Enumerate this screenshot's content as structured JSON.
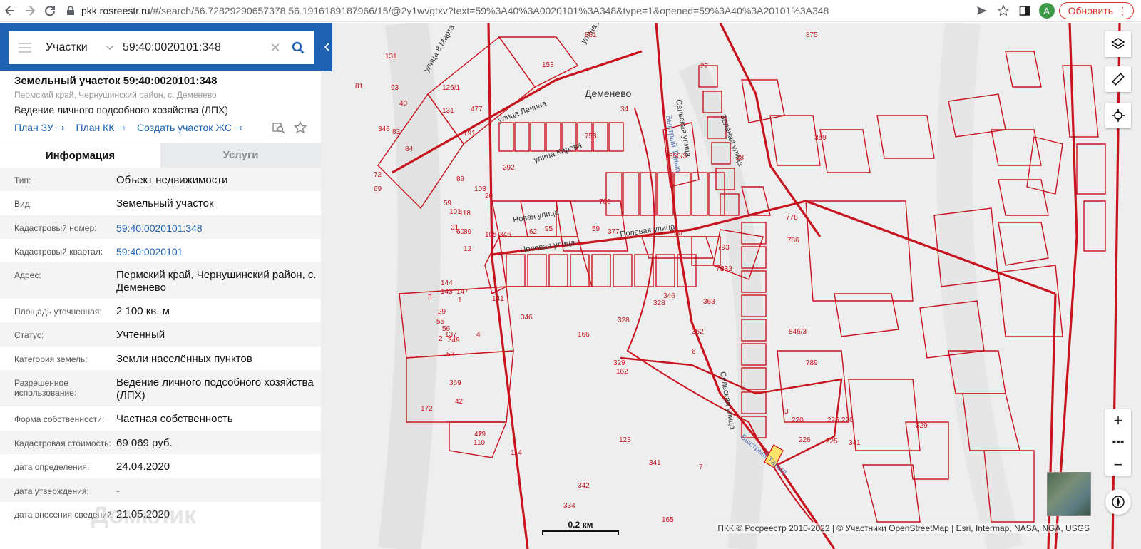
{
  "browser": {
    "url_host": "pkk.rosreestr.ru",
    "url_rest": "/#/search/56.72829290657378,56.1916189187966/15/@2y1wvgtxv?text=59%3A40%3A0020101%3A348&type=1&opened=59%3A40%3A20101%3A348",
    "avatar_letter": "A",
    "update_label": "Обновить",
    "icons": [
      "back-arrow-icon",
      "forward-arrow-icon",
      "reload-icon",
      "lock-icon",
      "send-icon",
      "star-icon",
      "sidebar-icon",
      "kebab-menu-icon"
    ]
  },
  "search": {
    "category": "Участки",
    "query": "59:40:0020101:348"
  },
  "object": {
    "title": "Земельный участок 59:40:0020101:348",
    "address_short": "Пермский край, Чернушинский район, с. Деменево",
    "use": "Ведение личного подсобного хозяйства (ЛПХ)",
    "links": [
      "План ЗУ",
      "План КК",
      "Создать участок ЖС"
    ]
  },
  "tabs": {
    "info": "Информация",
    "services": "Услуги"
  },
  "details": [
    {
      "k": "Тип:",
      "v": "Объект недвижимости"
    },
    {
      "k": "Вид:",
      "v": "Земельный участок"
    },
    {
      "k": "Кадастровый номер:",
      "v": "59:40:0020101:348",
      "link": true
    },
    {
      "k": "Кадастровый квартал:",
      "v": "59:40:0020101",
      "link": true
    },
    {
      "k": "Адрес:",
      "v": "Пермский край, Чернушинский район, с. Деменево"
    },
    {
      "k": "Площадь уточненная:",
      "v": "2 100 кв. м"
    },
    {
      "k": "Статус:",
      "v": "Учтенный"
    },
    {
      "k": "Категория земель:",
      "v": "Земли населённых пунктов"
    },
    {
      "k": "Разрешенное использование:",
      "v": "Ведение личного подсобного хозяйства (ЛПХ)"
    },
    {
      "k": "Форма собственности:",
      "v": "Частная собственность"
    },
    {
      "k": "Кадастровая стоимость:",
      "v": "69 069 руб."
    },
    {
      "k": "дата определения:",
      "v": "24.04.2020"
    },
    {
      "k": "дата утверждения:",
      "v": "-"
    },
    {
      "k": "дата внесения сведений:",
      "v": "21.05.2020"
    }
  ],
  "map": {
    "parcel_color": "#c8141e",
    "highlight_color": "#ffe26a",
    "village_label": "Деменево",
    "street_labels": [
      "Полевая улица",
      "Полевая улица",
      "Новая улица",
      "улица Кирова",
      "улица Ленина",
      "улица 8 Марта",
      "Сельская улица",
      "Сельская улица",
      "Зелёная улица",
      "улица Л"
    ],
    "river_labels": [
      "Быстрый Танып",
      "Быстрый Танып"
    ],
    "parcel_labels": [
      "153",
      "851",
      "40",
      "126/1",
      "131",
      "477",
      "34",
      "42",
      "81",
      "93",
      "131",
      "346",
      "83",
      "84",
      "72",
      "69",
      "89",
      "791",
      "753",
      "850/3",
      "760",
      "760",
      "346",
      "346",
      "346",
      "328",
      "328",
      "363",
      "362",
      "6",
      "793",
      "833",
      "793",
      "28",
      "27",
      "875",
      "359",
      "778",
      "786",
      "846/3",
      "789",
      "3",
      "226",
      "220",
      "225",
      "225",
      "220",
      "329",
      "329",
      "334",
      "341",
      "341",
      "342",
      "165",
      "7",
      "123",
      "292",
      "95",
      "101",
      "20",
      "103",
      "118",
      "89",
      "105",
      "12",
      "31",
      "62",
      "60",
      "59",
      "377",
      "56",
      "55",
      "29",
      "137",
      "349",
      "52",
      "369",
      "42",
      "110",
      "114",
      "144",
      "143",
      "147",
      "141",
      "1",
      "3",
      "2",
      "4",
      "172",
      "19",
      "166",
      "162",
      "59"
    ],
    "scale_label": "0.2 км",
    "attribution": "ПКК © Росреестр 2010-2022 | © Участники OpenStreetMap | Esri, Intermap, NASA, NGA, USGS",
    "watermark": "Домклик",
    "controls": [
      "layers-icon",
      "ruler-icon",
      "locate-icon",
      "zoom-in-icon",
      "more-icon",
      "zoom-out-icon",
      "compass-icon"
    ]
  }
}
